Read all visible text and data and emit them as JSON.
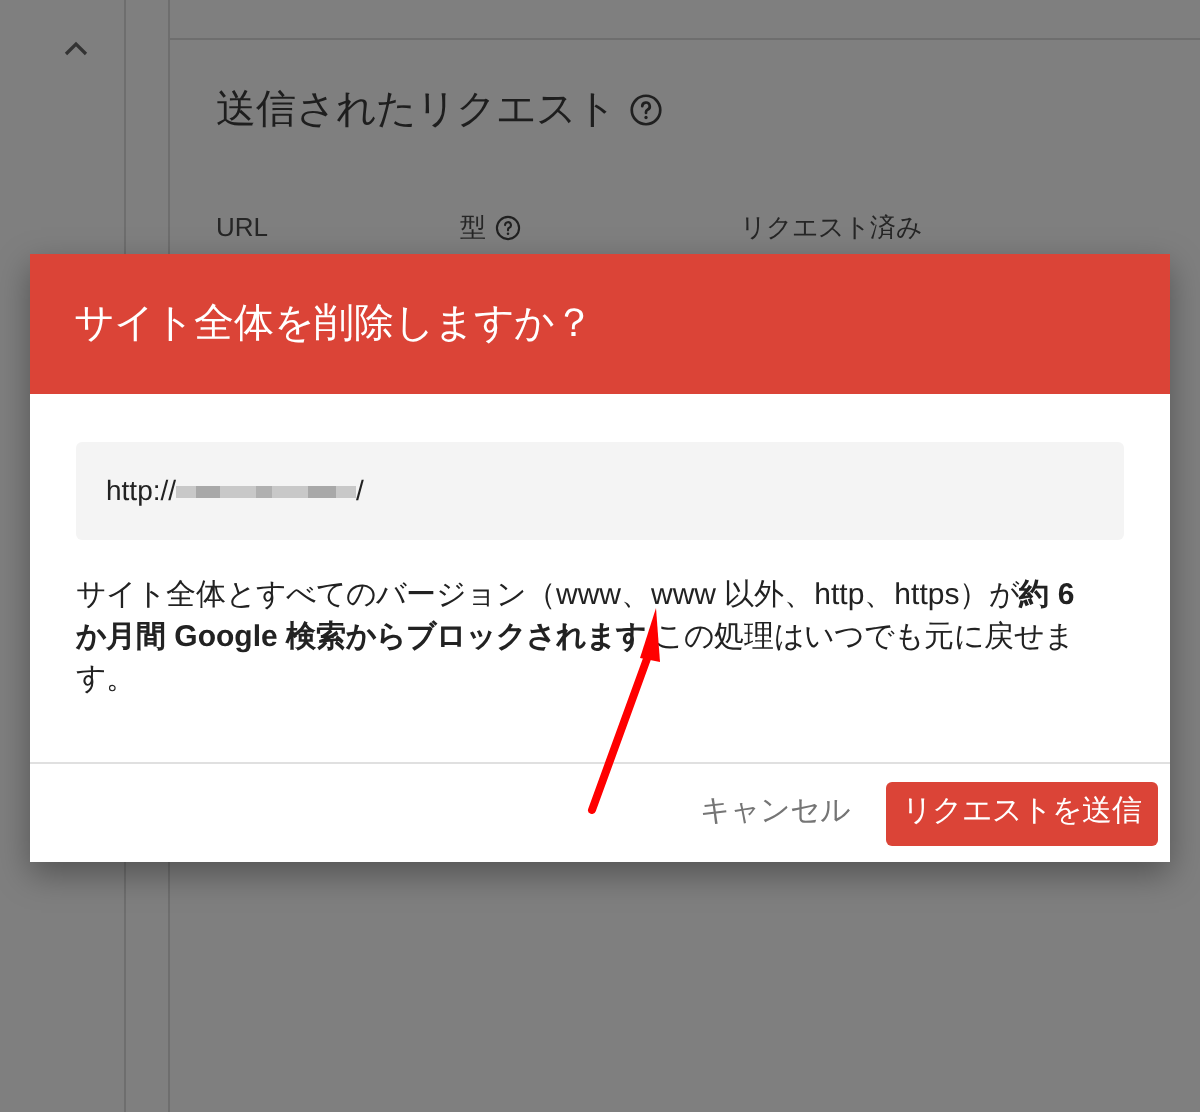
{
  "page": {
    "section_title": "送信されたリクエスト",
    "columns": [
      {
        "label": "URL",
        "help": false
      },
      {
        "label": "型",
        "help": true
      },
      {
        "label": "リクエスト済み",
        "help": false
      }
    ]
  },
  "dialog": {
    "title": "サイト全体を削除しますか？",
    "url_prefix": "http://",
    "url_suffix": "/",
    "message": "サイト全体とすべてのバージョン（www、www 以外、http、https）が**約 6 か月間 Google 検索からブロックされます** この処理はいつでも元に戻せます。",
    "buttons": [
      {
        "label": "キャンセル",
        "kind": "flat"
      },
      {
        "label": "リクエストを送信",
        "kind": "primary"
      }
    ]
  }
}
